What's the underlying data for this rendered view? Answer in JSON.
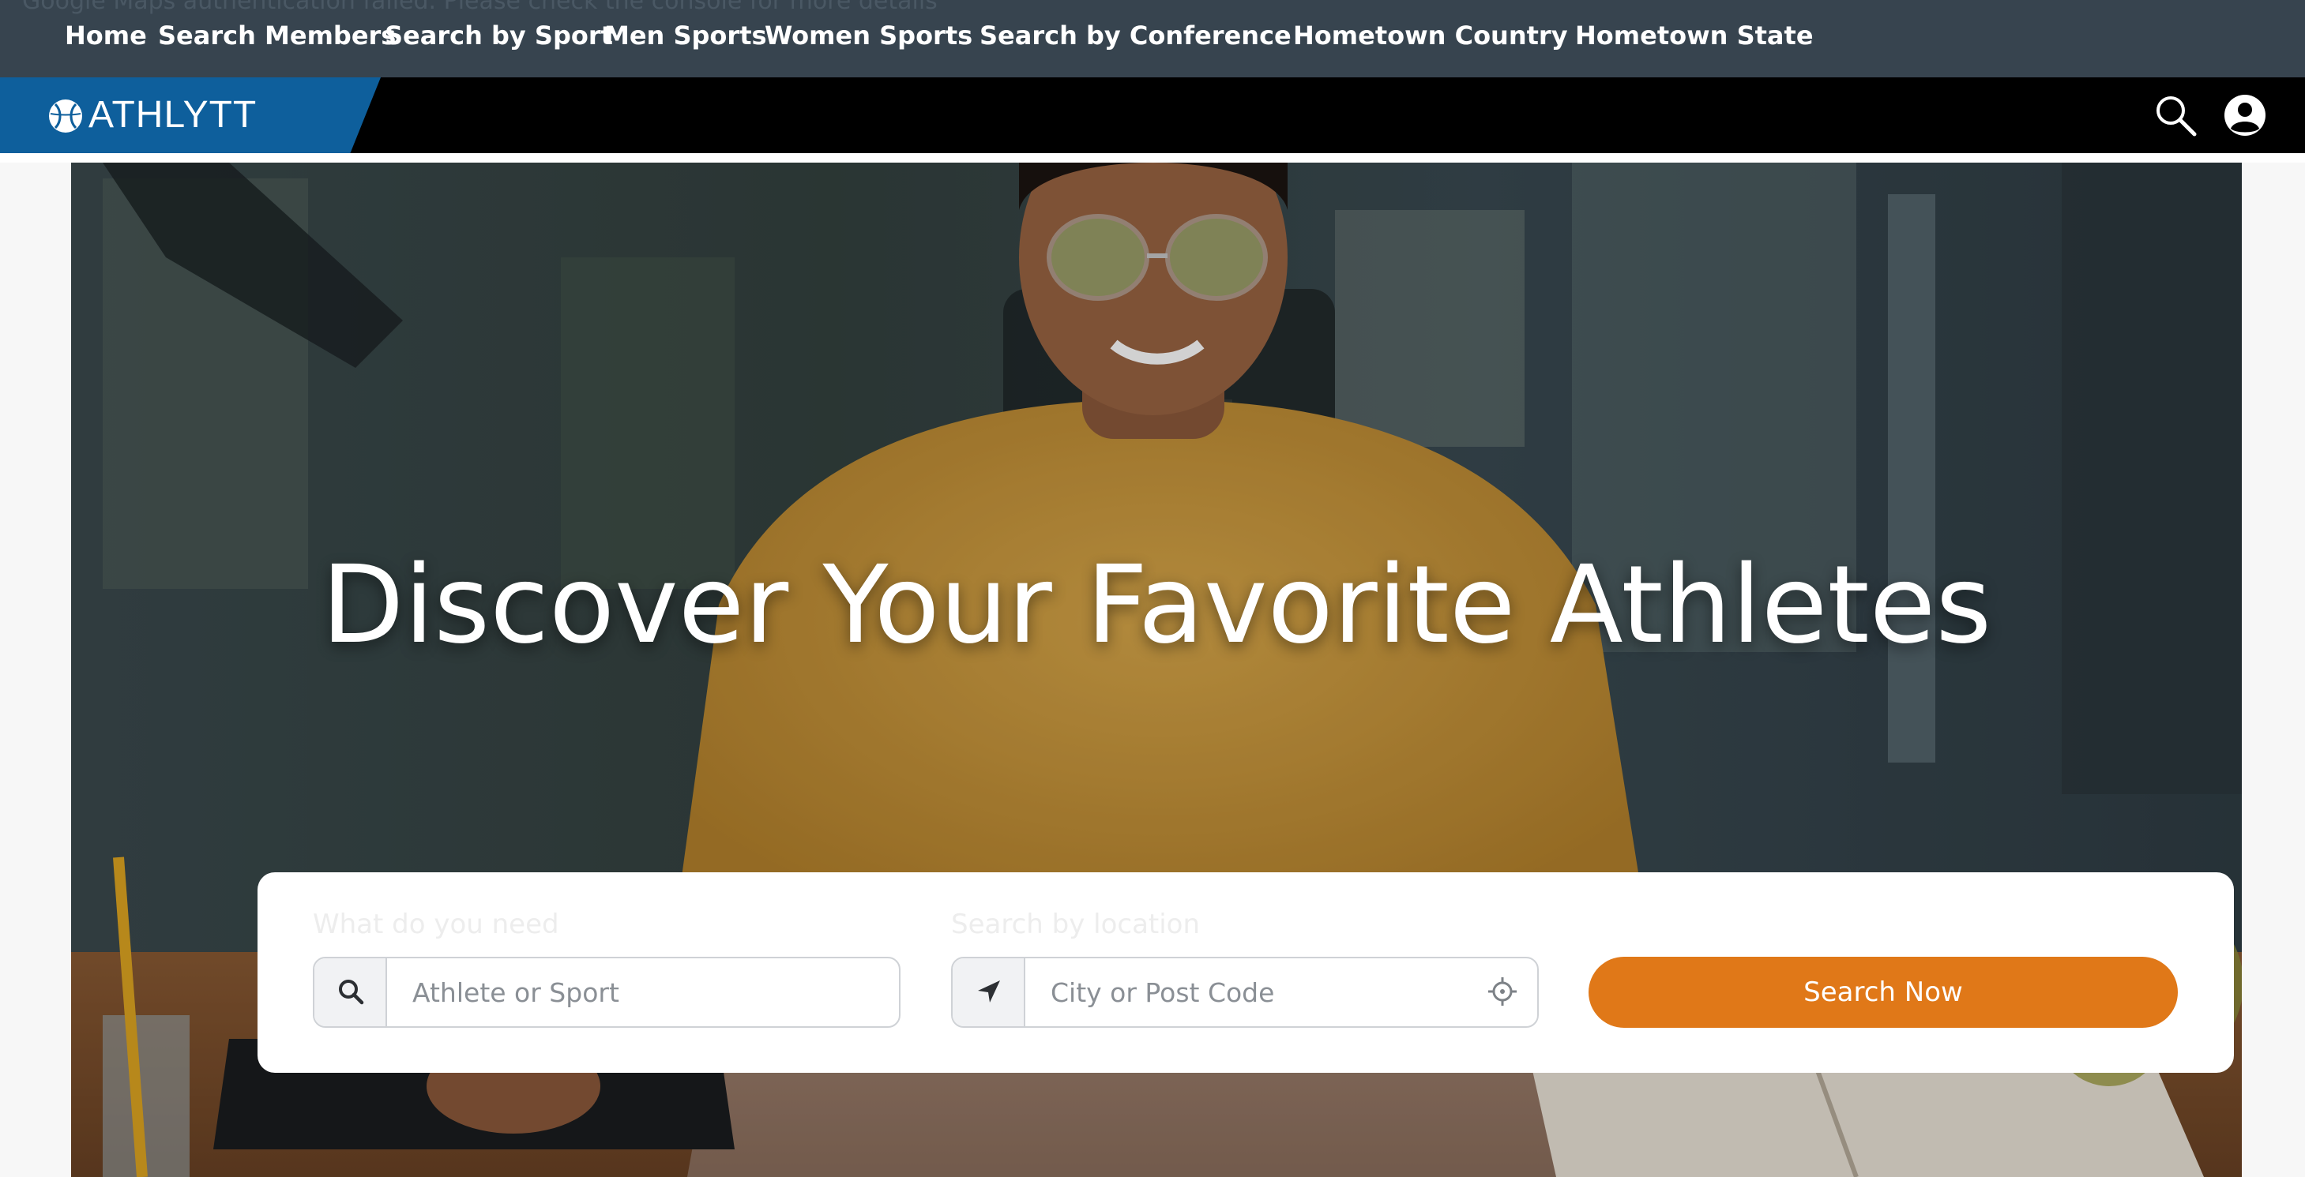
{
  "notice": {
    "text": "Google Maps authentication failed. Please check the console for more details"
  },
  "nav": {
    "items": [
      {
        "label": "Home"
      },
      {
        "label": "Search Members"
      },
      {
        "label": "Search by Sport"
      },
      {
        "label": "Men Sports"
      },
      {
        "label": "Women Sports"
      },
      {
        "label": "Search by Conference"
      },
      {
        "label": "Hometown Country"
      },
      {
        "label": "Hometown State"
      }
    ]
  },
  "header": {
    "logo_text": "ATHLYTT",
    "logo_icon": "baseball-icon",
    "search_icon": "search-icon",
    "account_icon": "user-circle-icon"
  },
  "hero": {
    "title": "Discover Your Favorite Athletes"
  },
  "search_card": {
    "what_label": "What do you need",
    "what_placeholder": "Athlete or Sport",
    "location_label": "Search by location",
    "location_placeholder": "City or Post Code",
    "submit_label": "Search Now"
  },
  "colors": {
    "topnav_bg": "#37444f",
    "logo_bg": "#0e5f9c",
    "header_bg": "#000000",
    "button_bg": "#e07818"
  }
}
